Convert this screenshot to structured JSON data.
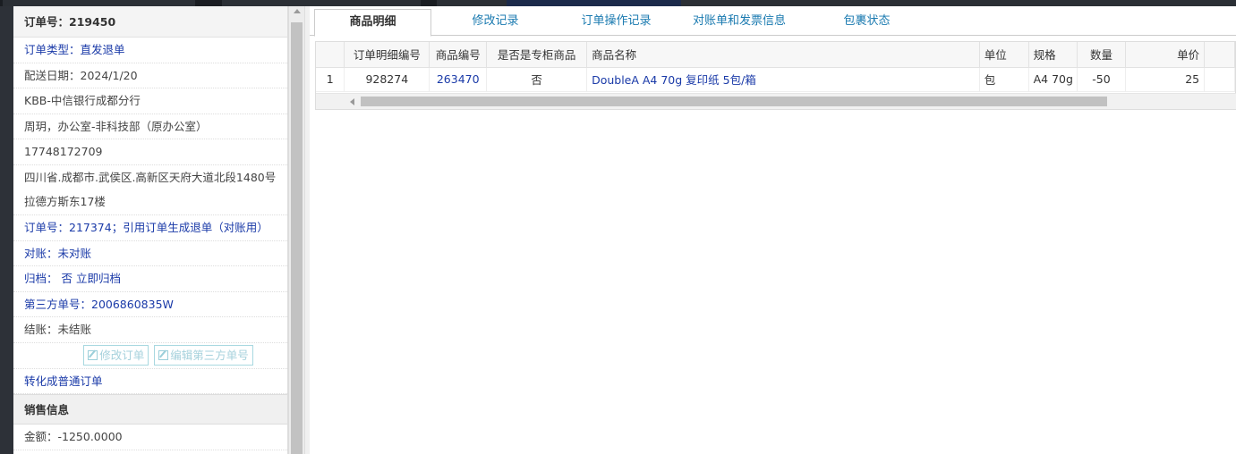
{
  "order": {
    "number_label": "订单号：219450",
    "type_label": "订单类型：直发退单",
    "delivery_date": "配送日期：2024/1/20",
    "company": "KBB-中信银行成都分行",
    "contact": "周玥，办公室-非科技部（原办公室）",
    "phone": "17748172709",
    "address": "四川省.成都市.武侯区.高新区天府大道北段1480号拉德方斯东17楼",
    "ref_order": "订单号：217374；引用订单生成退单（对账用）",
    "reconcile": "对账：未对账",
    "archive": "归档： 否 立即归档",
    "third_party": "第三方单号：2006860835W",
    "settlement": "结账：未结账",
    "edit_order_btn": "修改订单",
    "edit_third_btn": "编辑第三方单号",
    "convert_link": "转化成普通订单"
  },
  "sales": {
    "section_title": "销售信息",
    "amount": "金额：-1250.0000"
  },
  "tabs": [
    "商品明细",
    "修改记录",
    "订单操作记录",
    "对账单和发票信息",
    "包裹状态"
  ],
  "table": {
    "columns": [
      "",
      "订单明细编号",
      "商品编号",
      "是否是专柜商品",
      "商品名称",
      "单位",
      "规格",
      "数量",
      "单价"
    ],
    "rows": [
      [
        "1",
        "928274",
        "263470",
        "否",
        "DoubleA A4 70g 复印纸 5包/箱",
        "包",
        "A4 70g",
        "-50",
        "25"
      ]
    ]
  },
  "colors": {
    "link_blue": "#1a3aa8",
    "tab_blue": "#1a7ab0"
  }
}
